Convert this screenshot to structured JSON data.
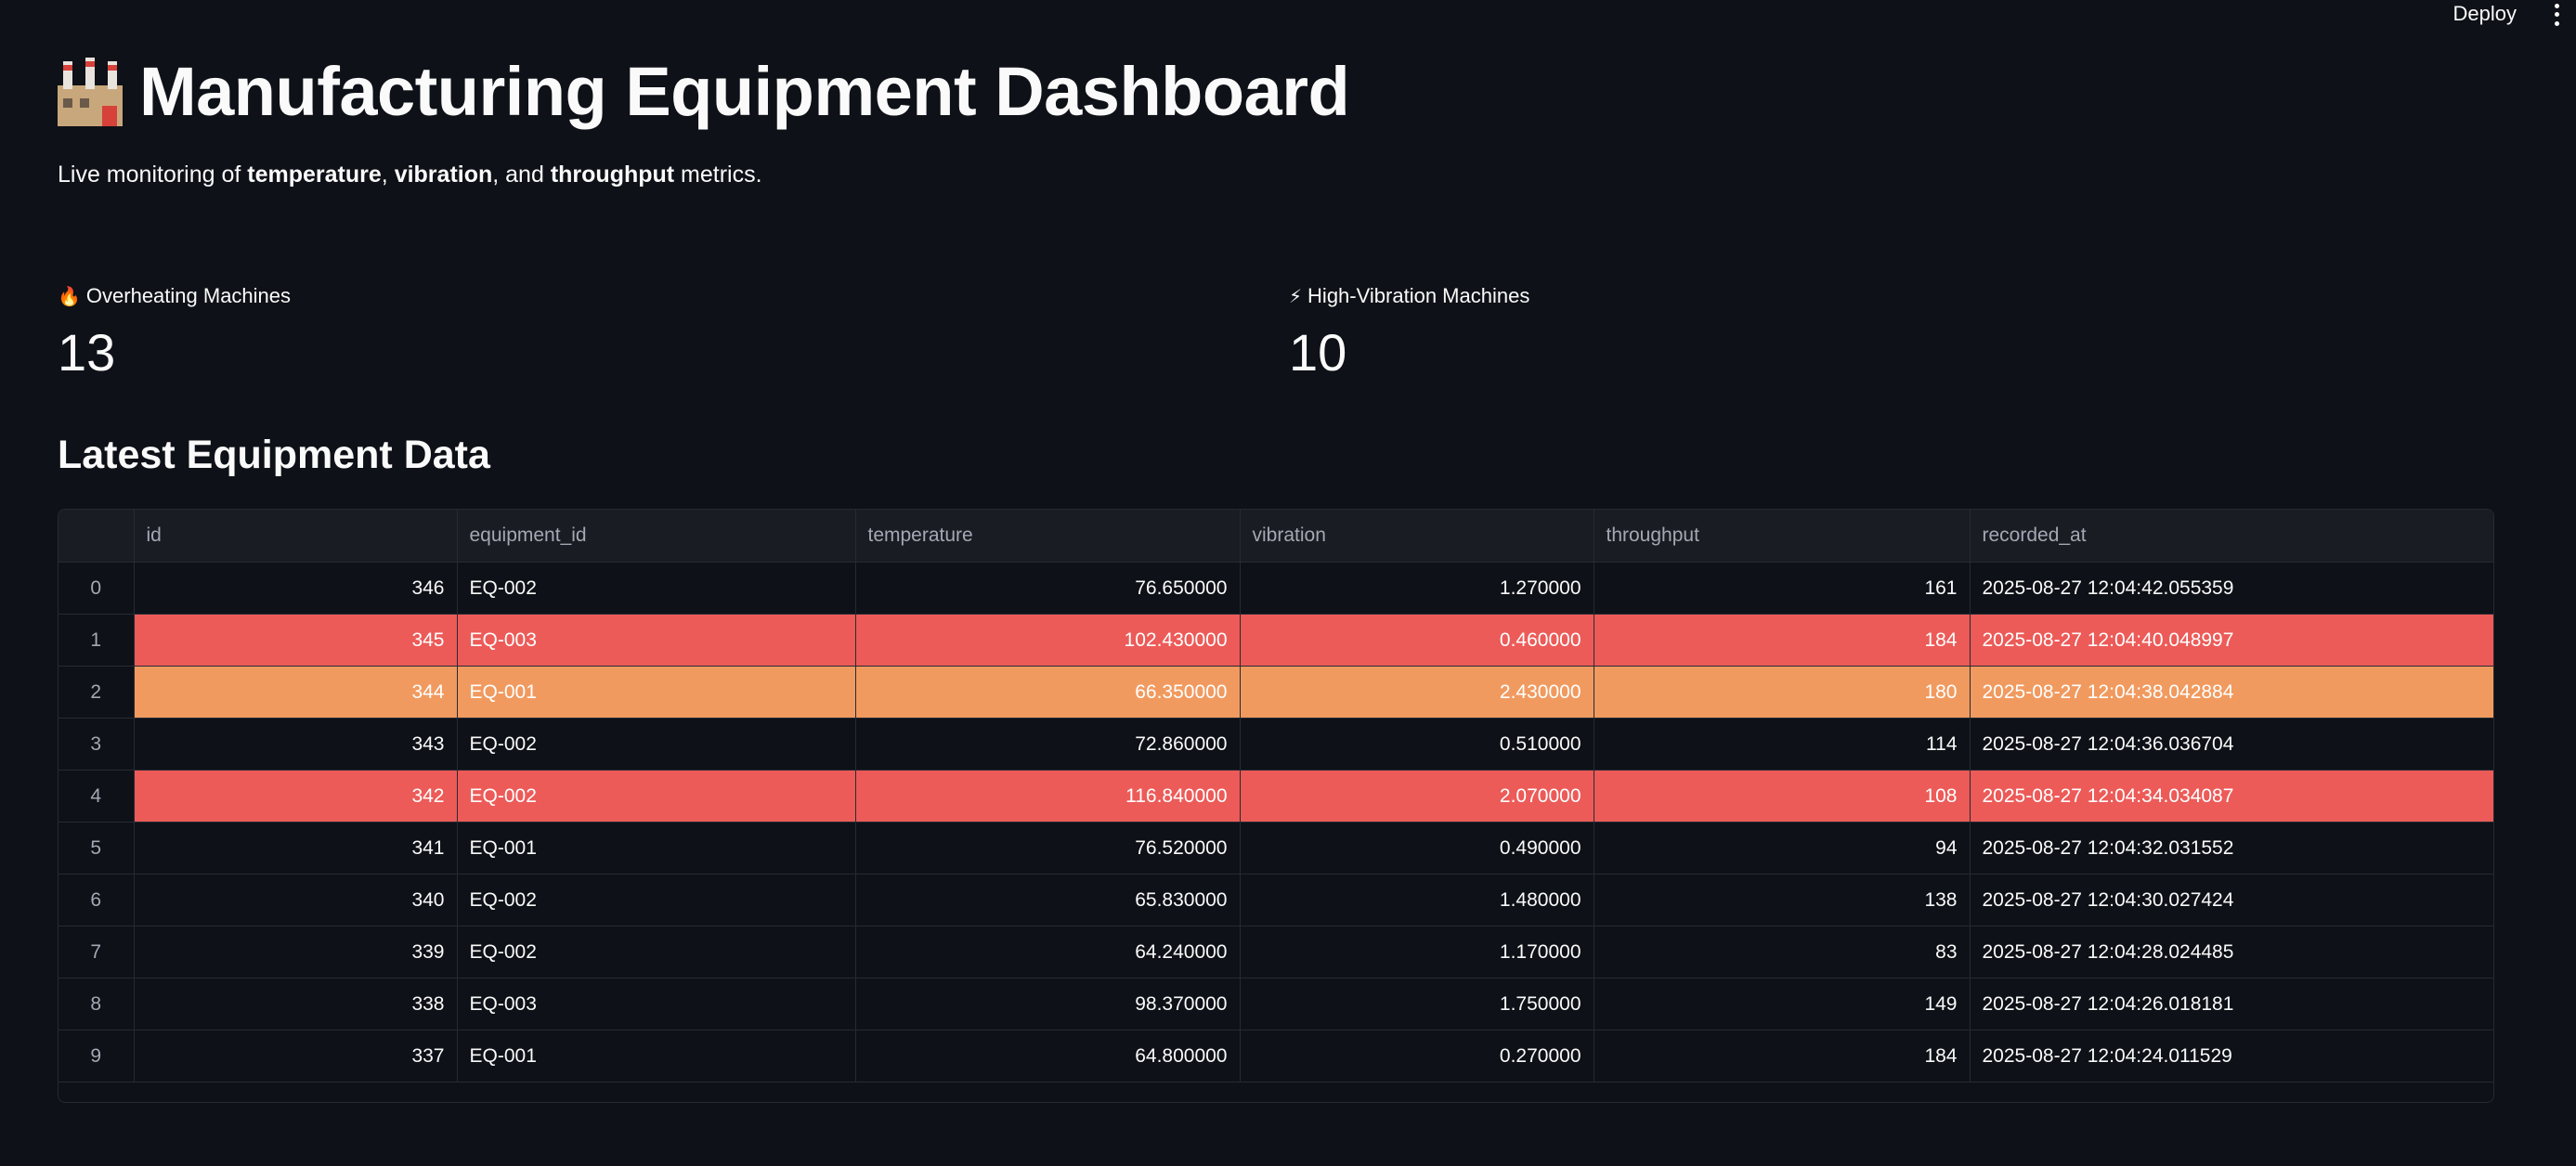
{
  "topbar": {
    "deploy_label": "Deploy",
    "menu_icon": "more-vertical-icon"
  },
  "header": {
    "title": "Manufacturing Equipment Dashboard",
    "title_icon": "factory-icon",
    "subtitle_prefix": "Live monitoring of ",
    "subtitle_b1": "temperature",
    "subtitle_sep1": ", ",
    "subtitle_b2": "vibration",
    "subtitle_sep2": ", and ",
    "subtitle_b3": "throughput",
    "subtitle_suffix": " metrics."
  },
  "metrics": [
    {
      "icon": "fire-icon",
      "icon_glyph": "🔥",
      "label": "Overheating Machines",
      "value": "13"
    },
    {
      "icon": "lightning-icon",
      "icon_glyph": "⚡",
      "label": "High-Vibration Machines",
      "value": "10"
    }
  ],
  "section_title": "Latest Equipment Data",
  "table": {
    "columns": [
      "",
      "id",
      "equipment_id",
      "temperature",
      "vibration",
      "throughput",
      "recorded_at"
    ],
    "highlight_colors": {
      "red": "#ec5b58",
      "orange": "#f19a5f"
    },
    "rows": [
      {
        "idx": "0",
        "id": "346",
        "equipment_id": "EQ-002",
        "temperature": "76.650000",
        "vibration": "1.270000",
        "throughput": "161",
        "recorded_at": "2025-08-27 12:04:42.055359",
        "highlight": "none"
      },
      {
        "idx": "1",
        "id": "345",
        "equipment_id": "EQ-003",
        "temperature": "102.430000",
        "vibration": "0.460000",
        "throughput": "184",
        "recorded_at": "2025-08-27 12:04:40.048997",
        "highlight": "red"
      },
      {
        "idx": "2",
        "id": "344",
        "equipment_id": "EQ-001",
        "temperature": "66.350000",
        "vibration": "2.430000",
        "throughput": "180",
        "recorded_at": "2025-08-27 12:04:38.042884",
        "highlight": "orange"
      },
      {
        "idx": "3",
        "id": "343",
        "equipment_id": "EQ-002",
        "temperature": "72.860000",
        "vibration": "0.510000",
        "throughput": "114",
        "recorded_at": "2025-08-27 12:04:36.036704",
        "highlight": "none"
      },
      {
        "idx": "4",
        "id": "342",
        "equipment_id": "EQ-002",
        "temperature": "116.840000",
        "vibration": "2.070000",
        "throughput": "108",
        "recorded_at": "2025-08-27 12:04:34.034087",
        "highlight": "red"
      },
      {
        "idx": "5",
        "id": "341",
        "equipment_id": "EQ-001",
        "temperature": "76.520000",
        "vibration": "0.490000",
        "throughput": "94",
        "recorded_at": "2025-08-27 12:04:32.031552",
        "highlight": "none"
      },
      {
        "idx": "6",
        "id": "340",
        "equipment_id": "EQ-002",
        "temperature": "65.830000",
        "vibration": "1.480000",
        "throughput": "138",
        "recorded_at": "2025-08-27 12:04:30.027424",
        "highlight": "none"
      },
      {
        "idx": "7",
        "id": "339",
        "equipment_id": "EQ-002",
        "temperature": "64.240000",
        "vibration": "1.170000",
        "throughput": "83",
        "recorded_at": "2025-08-27 12:04:28.024485",
        "highlight": "none"
      },
      {
        "idx": "8",
        "id": "338",
        "equipment_id": "EQ-003",
        "temperature": "98.370000",
        "vibration": "1.750000",
        "throughput": "149",
        "recorded_at": "2025-08-27 12:04:26.018181",
        "highlight": "none"
      },
      {
        "idx": "9",
        "id": "337",
        "equipment_id": "EQ-001",
        "temperature": "64.800000",
        "vibration": "0.270000",
        "throughput": "184",
        "recorded_at": "2025-08-27 12:04:24.011529",
        "highlight": "none"
      }
    ]
  }
}
